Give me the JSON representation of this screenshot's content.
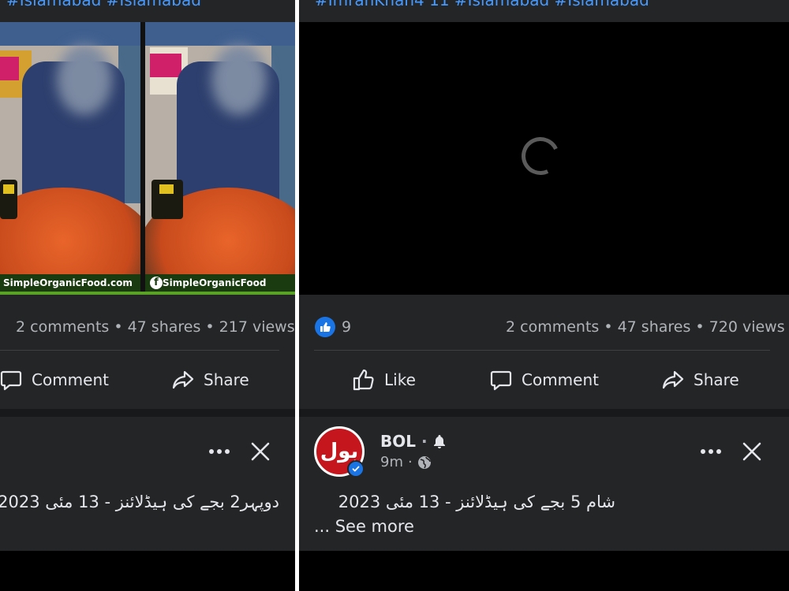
{
  "left_post": {
    "hashtags": "#Islamabad #Islamabad",
    "video_watermark_left": "SimpleOrganicFood.com",
    "video_watermark_right": "SimpleOrganicFood",
    "stats": "2 comments • 47 shares • 217 views",
    "actions": {
      "comment": "Comment",
      "share": "Share"
    },
    "next_post_text": "دوپہر2 بجے کی ہیڈلائنز - 13 مئی 2023"
  },
  "right_post": {
    "hashtags": "#ImranKhan4 11 #Islamabad #Islamabad",
    "like_count": "9",
    "stats": "2 comments • 47 shares • 720 views",
    "actions": {
      "like": "Like",
      "comment": "Comment",
      "share": "Share"
    },
    "next_post": {
      "avatar_text": "بول",
      "page_name": "BOL",
      "time": "9m",
      "text": "شام 5 بجے کی ہیڈلائنز - 13 مئی 2023",
      "see_more": "... See more"
    }
  },
  "icons": {
    "like": "thumbs-up-icon",
    "comment": "speech-bubble-icon",
    "share": "share-arrow-icon",
    "more": "more-dots-icon",
    "close": "close-icon",
    "bell": "bell-icon",
    "globe": "globe-icon",
    "verified": "verified-badge-icon"
  },
  "colors": {
    "card_bg": "#242526",
    "accent_blue": "#1b74e4",
    "hashtag_blue": "#4599ff",
    "bol_red": "#c4161c"
  }
}
